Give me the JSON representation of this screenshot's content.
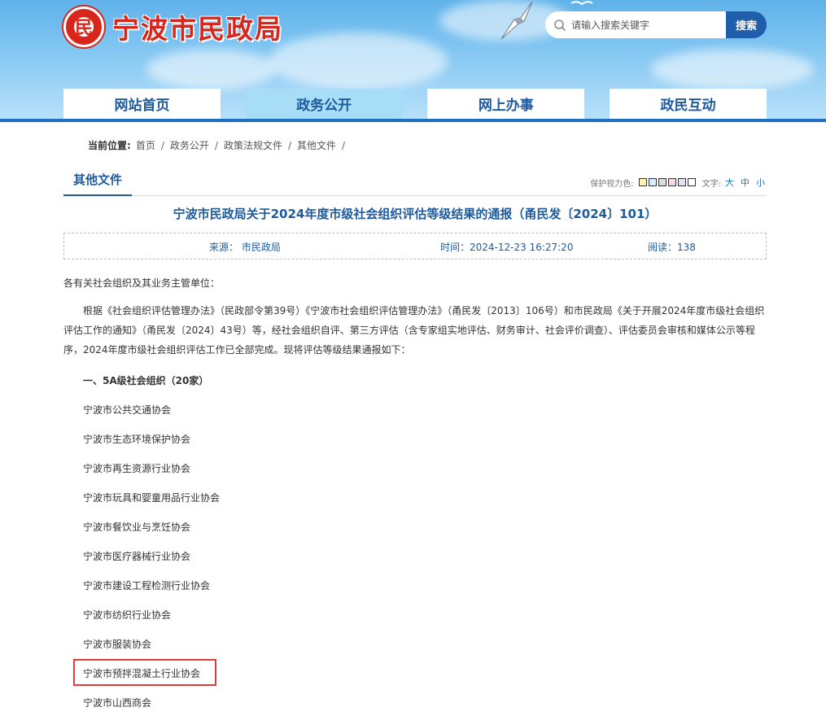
{
  "site": {
    "name": "宁波市民政局"
  },
  "search": {
    "placeholder": "请输入搜索关键字",
    "button_label": "搜索"
  },
  "nav": {
    "items": [
      {
        "label": "网站首页",
        "active": false
      },
      {
        "label": "政务公开",
        "active": true
      },
      {
        "label": "网上办事",
        "active": false
      },
      {
        "label": "政民互动",
        "active": false
      }
    ]
  },
  "breadcrumb": {
    "label": "当前位置:",
    "items": [
      "首页",
      "政务公开",
      "政策法规文件",
      "其他文件"
    ],
    "separator": "/"
  },
  "column": {
    "tab_label": "其他文件",
    "eye_protect_label": "保护视力色:",
    "eye_colors": [
      "#fdf5b0",
      "#d8ecfb",
      "#dcdcdc",
      "#f9d7e5",
      "#e5e0f5",
      "#ffffff"
    ],
    "font_size_label": "文字:",
    "font_sizes": [
      "大",
      "中",
      "小"
    ]
  },
  "article": {
    "title": "宁波市民政局关于2024年度市级社会组织评估等级结果的通报（甬民发〔2024〕101）",
    "source": "来源：  市民政局",
    "time": "时间：2024-12-23 16:27:20",
    "reads": "阅读：138",
    "salutation": "各有关社会组织及其业务主管单位：",
    "paragraph": "根据《社会组织评估管理办法》（民政部令第39号）《宁波市社会组织评估管理办法》（甬民发〔2013〕106号）和市民政局《关于开展2024年度市级社会组织评估工作的通知》（甬民发〔2024〕43号）等，经社会组织自评、第三方评估（含专家组实地评估、财务审计、社会评价调查）、评估委员会审核和媒体公示等程序，2024年度市级社会组织评估工作已全部完成。现将评估等级结果通报如下：",
    "section_heading": "一、5A级社会组织（20家）",
    "organizations": [
      "宁波市公共交通协会",
      "宁波市生态环境保护协会",
      "宁波市再生资源行业协会",
      "宁波市玩具和婴童用品行业协会",
      "宁波市餐饮业与烹饪协会",
      "宁波市医疗器械行业协会",
      "宁波市建设工程检测行业协会",
      "宁波市纺织行业协会",
      "宁波市服装协会",
      "宁波市预拌混凝土行业协会",
      "宁波市山西商会"
    ]
  },
  "colors": {
    "accent_blue": "#1e5a9c",
    "logo_red": "#d8261c",
    "highlight_red": "#e03c3c"
  }
}
